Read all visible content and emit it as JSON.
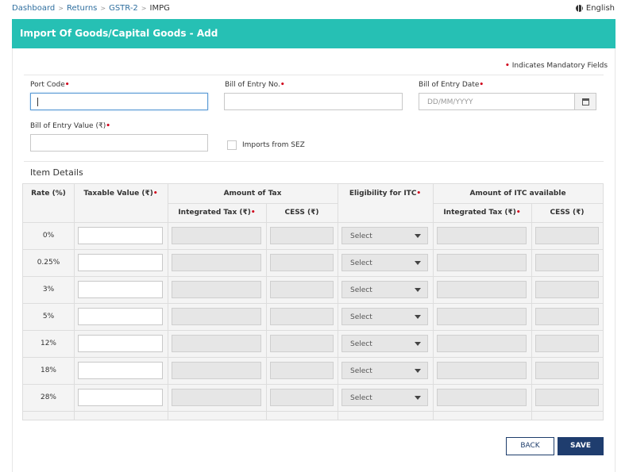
{
  "breadcrumb": {
    "items": [
      "Dashboard",
      "Returns",
      "GSTR-2"
    ],
    "current": "IMPG",
    "separator": ">"
  },
  "language": "English",
  "page": {
    "title": "Import Of Goods/Capital Goods - Add",
    "mandatory_note": "Indicates Mandatory Fields",
    "required_marker": "•"
  },
  "form": {
    "port_code": {
      "label": "Port Code",
      "value": ""
    },
    "bill_of_entry_no": {
      "label": "Bill of Entry No.",
      "value": ""
    },
    "bill_of_entry_date": {
      "label": "Bill of Entry Date",
      "placeholder": "DD/MM/YYYY"
    },
    "bill_of_entry_value": {
      "label": "Bill of Entry Value (₹)",
      "value": ""
    },
    "imports_from_sez": {
      "label": "Imports from SEZ",
      "checked": false
    }
  },
  "item_details": {
    "heading": "Item Details",
    "headers": {
      "rate": "Rate (%)",
      "taxable_value": "Taxable Value (₹)",
      "amount_of_tax": "Amount of Tax",
      "integrated_tax": "Integrated Tax (₹)",
      "cess": "CESS (₹)",
      "eligibility": "Eligibility for ITC",
      "itc_available": "Amount of ITC available",
      "itc_integrated_tax": "Integrated Tax (₹)",
      "itc_cess": "CESS (₹)"
    },
    "rows": [
      {
        "rate": "0%",
        "eligibility": "Select"
      },
      {
        "rate": "0.25%",
        "eligibility": "Select"
      },
      {
        "rate": "3%",
        "eligibility": "Select"
      },
      {
        "rate": "5%",
        "eligibility": "Select"
      },
      {
        "rate": "12%",
        "eligibility": "Select"
      },
      {
        "rate": "18%",
        "eligibility": "Select"
      },
      {
        "rate": "28%",
        "eligibility": "Select"
      }
    ]
  },
  "buttons": {
    "back": "BACK",
    "save": "SAVE"
  },
  "colors": {
    "title_bar": "#26c0b4",
    "save_button": "#1f3d6e",
    "required": "#d0021b",
    "link": "#2f6f9f"
  }
}
